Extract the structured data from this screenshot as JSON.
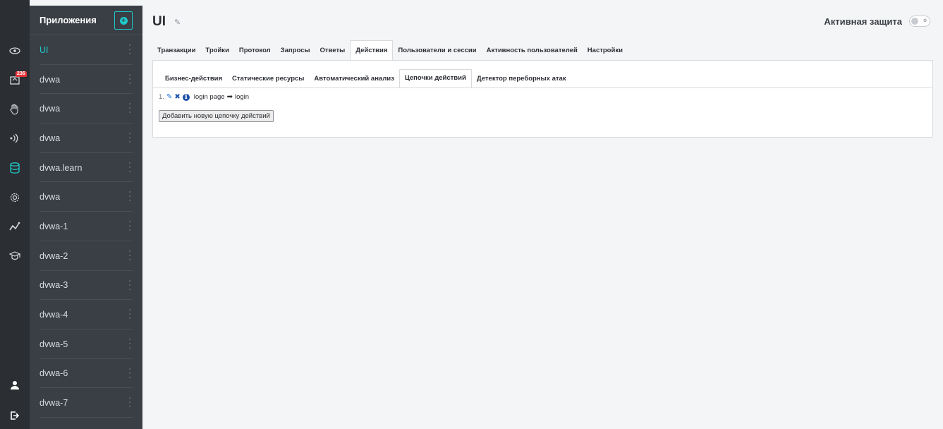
{
  "sidebar_icons": {
    "notification_badge": "236"
  },
  "apps": {
    "header": "Приложения",
    "items": [
      {
        "label": "UI",
        "active": true
      },
      {
        "label": "dvwa"
      },
      {
        "label": "dvwa"
      },
      {
        "label": "dvwa"
      },
      {
        "label": "dvwa.learn"
      },
      {
        "label": "dvwa"
      },
      {
        "label": "dvwa-1"
      },
      {
        "label": "dvwa-2"
      },
      {
        "label": "dvwa-3"
      },
      {
        "label": "dvwa-4"
      },
      {
        "label": "dvwa-5"
      },
      {
        "label": "dvwa-6"
      },
      {
        "label": "dvwa-7"
      }
    ]
  },
  "header": {
    "title": "UI",
    "active_protection_label": "Активная защита"
  },
  "tabs": [
    "Транзакции",
    "Тройки",
    "Протокол",
    "Запросы",
    "Ответы",
    "Действия",
    "Пользователи и сессии",
    "Активность пользователей",
    "Настройки"
  ],
  "subtabs": [
    "Бизнес-действия",
    "Статические ресурсы",
    "Автоматический анализ",
    "Цепочки действий",
    "Детектор переборных атак"
  ],
  "chain": {
    "number": "1.",
    "from": "login page",
    "to": "login"
  },
  "add_chain_button": "Добавить новую цепочку действий",
  "colors": {
    "accent": "#1fc8c8",
    "sidebar_dark": "#2b2e33",
    "apps_panel": "#3a3e45",
    "badge": "#e8343d"
  }
}
